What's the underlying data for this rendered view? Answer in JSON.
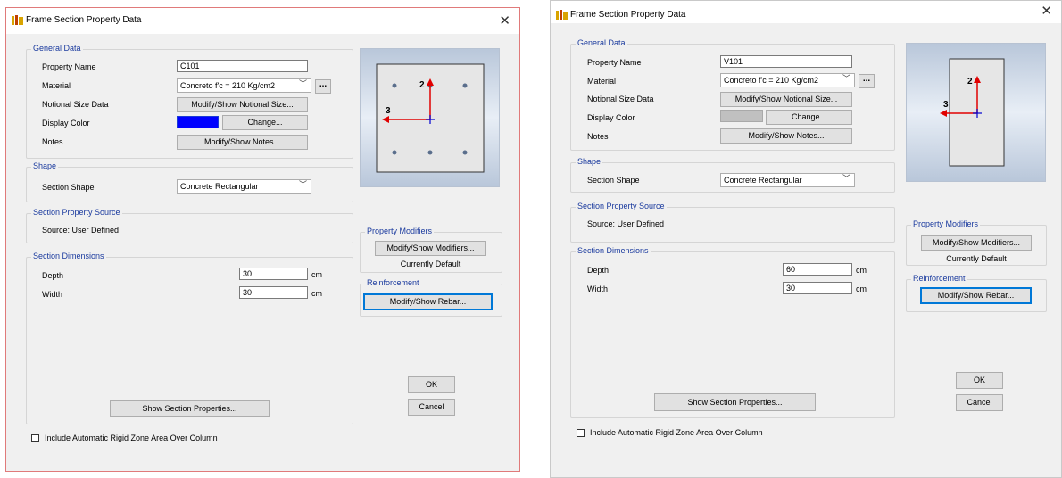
{
  "windows": [
    {
      "title": "Frame Section Property Data",
      "general": {
        "legend": "General Data",
        "property_name_label": "Property Name",
        "property_name_value": "C101",
        "material_label": "Material",
        "material_value": "Concreto f'c = 210 Kg/cm2",
        "material_more": "...",
        "notional_label": "Notional Size Data",
        "notional_button": "Modify/Show Notional Size...",
        "color_label": "Display Color",
        "color_value": "#0000ff",
        "change_button": "Change...",
        "notes_label": "Notes",
        "notes_button": "Modify/Show Notes..."
      },
      "shape": {
        "legend": "Shape",
        "label": "Section Shape",
        "value": "Concrete Rectangular"
      },
      "source": {
        "legend": "Section Property Source",
        "text": "Source:  User Defined"
      },
      "dims": {
        "legend": "Section Dimensions",
        "depth_label": "Depth",
        "depth_value": "30",
        "depth_unit": "cm",
        "width_label": "Width",
        "width_value": "30",
        "width_unit": "cm"
      },
      "show_props_button": "Show Section Properties...",
      "preview": {
        "axis2": "2",
        "axis3": "3"
      },
      "modifiers": {
        "legend": "Property Modifiers",
        "button": "Modify/Show Modifiers...",
        "status": "Currently Default"
      },
      "reinforcement": {
        "legend": "Reinforcement",
        "button": "Modify/Show Rebar..."
      },
      "ok_button": "OK",
      "cancel_button": "Cancel",
      "rigid_zone_label": "Include Automatic Rigid Zone Area Over Column"
    },
    {
      "title": "Frame Section Property Data",
      "general": {
        "legend": "General Data",
        "property_name_label": "Property Name",
        "property_name_value": "V101",
        "material_label": "Material",
        "material_value": "Concreto f'c = 210 Kg/cm2",
        "material_more": "...",
        "notional_label": "Notional Size Data",
        "notional_button": "Modify/Show Notional Size...",
        "color_label": "Display Color",
        "color_value": "#c0c0c0",
        "change_button": "Change...",
        "notes_label": "Notes",
        "notes_button": "Modify/Show Notes..."
      },
      "shape": {
        "legend": "Shape",
        "label": "Section Shape",
        "value": "Concrete Rectangular"
      },
      "source": {
        "legend": "Section Property Source",
        "text": "Source:  User Defined"
      },
      "dims": {
        "legend": "Section Dimensions",
        "depth_label": "Depth",
        "depth_value": "60",
        "depth_unit": "cm",
        "width_label": "Width",
        "width_value": "30",
        "width_unit": "cm"
      },
      "show_props_button": "Show Section Properties...",
      "preview": {
        "axis2": "2",
        "axis3": "3"
      },
      "modifiers": {
        "legend": "Property Modifiers",
        "button": "Modify/Show Modifiers...",
        "status": "Currently Default"
      },
      "reinforcement": {
        "legend": "Reinforcement",
        "button": "Modify/Show Rebar..."
      },
      "ok_button": "OK",
      "cancel_button": "Cancel",
      "rigid_zone_label": "Include Automatic Rigid Zone Area Over Column"
    }
  ]
}
